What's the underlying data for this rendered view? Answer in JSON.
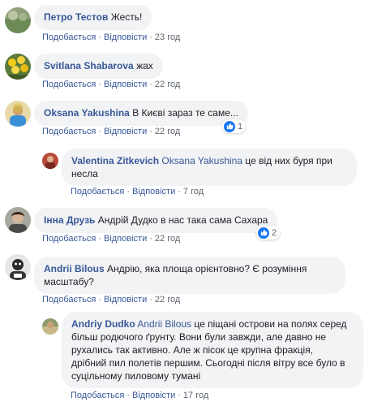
{
  "actions": {
    "like": "Подобається",
    "reply": "Відповісти",
    "separator": "·"
  },
  "comments": [
    {
      "author": "Петро Тестов",
      "text": "Жесть!",
      "time": "23 год"
    },
    {
      "author": "Svitlana Shabarova",
      "text": "жах",
      "time": "22 год"
    },
    {
      "author": "Oksana Yakushina",
      "text": "В Києві зараз те саме...",
      "time": "22 год",
      "reactions": "1"
    },
    {
      "author": "Valentina Zitkevich",
      "mention": "Oksana Yakushina",
      "text_line1": "це від них буря при",
      "text_line2": "несла",
      "time": "7 год"
    },
    {
      "author": "Інна Друзь",
      "text": "Андрій Дудко в нас така сама Сахара",
      "time": "22 год",
      "reactions": "2"
    },
    {
      "author": "Andrii Bilous",
      "text_line1": "Андрію, яка площа орієнтовно? Є розуміння",
      "text_line2": "масштабу?",
      "time": "22 год"
    },
    {
      "author": "Andriy Dudko",
      "mention": "Andrii Bilous",
      "text_line1": "це піщані острови на полях серед",
      "text_line2": "більш родючого ґрунту. Вони були завжди, але давно не",
      "text_line3": "рухались так активно. Але ж пісок це крупна фракція,",
      "text_line4": "дрібний пил полетів першим. Сьогодні після вітру все було в",
      "text_line5": "суцільному пиловому тумані",
      "time": "17 год"
    }
  ],
  "icons": {
    "like": "thumbs-up-icon"
  },
  "colors": {
    "link": "#385898",
    "bubble": "#f2f3f5",
    "like_blue": "#1877f2",
    "meta": "#606770"
  }
}
